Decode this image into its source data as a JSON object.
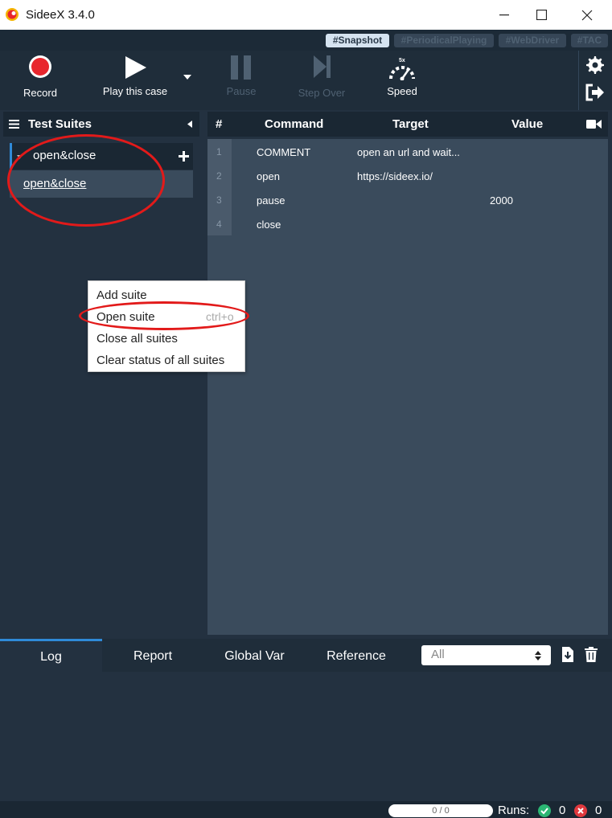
{
  "window": {
    "title": "SideeX 3.4.0"
  },
  "tags": [
    "#Snapshot",
    "#PeriodicalPlaying",
    "#WebDriver",
    "#TAC"
  ],
  "toolbar": {
    "record": "Record",
    "play": "Play this case",
    "pause": "Pause",
    "step_over": "Step Over",
    "speed": "Speed",
    "speed_value": "5x"
  },
  "sidebar": {
    "title": "Test Suites",
    "suite": "open&close",
    "case": "open&close"
  },
  "table": {
    "columns": [
      "#",
      "Command",
      "Target",
      "Value"
    ],
    "rows": [
      {
        "num": "1",
        "command": "COMMENT",
        "target": "open an url and wait...",
        "value": ""
      },
      {
        "num": "2",
        "command": "open",
        "target": "https://sideex.io/",
        "value": ""
      },
      {
        "num": "3",
        "command": "pause",
        "target": "",
        "value": "2000"
      },
      {
        "num": "4",
        "command": "close",
        "target": "",
        "value": ""
      }
    ]
  },
  "context_menu": {
    "items": [
      {
        "label": "Add suite",
        "shortcut": ""
      },
      {
        "label": "Open suite",
        "shortcut": "ctrl+o"
      },
      {
        "label": "Close all suites",
        "shortcut": ""
      },
      {
        "label": "Clear status of all suites",
        "shortcut": ""
      }
    ]
  },
  "bottom": {
    "tabs": [
      "Log",
      "Report",
      "Global Var",
      "Reference"
    ],
    "filter_value": "All"
  },
  "status": {
    "progress": "0 / 0",
    "runs_label": "Runs:",
    "passed": "0",
    "failed": "0"
  },
  "colors": {
    "accent": "#2f8ad8",
    "record": "#e8262d",
    "annotation": "#e21a1a",
    "pass": "#2bb673",
    "fail": "#e0393e"
  }
}
